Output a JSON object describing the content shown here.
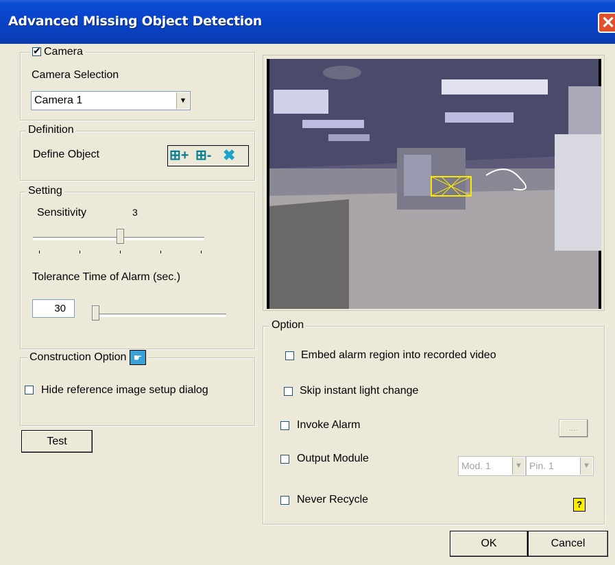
{
  "window": {
    "title": "Advanced Missing Object Detection"
  },
  "camera": {
    "group_label": "Camera",
    "checked": true,
    "selection_label": "Camera Selection",
    "selected": "Camera 1"
  },
  "definition": {
    "group_label": "Definition",
    "define_object_label": "Define Object",
    "tools": [
      "add-region-icon",
      "remove-region-icon",
      "clear-region-icon"
    ]
  },
  "setting": {
    "group_label": "Setting",
    "sensitivity_label": "Sensitivity",
    "sensitivity_value": "3",
    "tolerance_label": "Tolerance Time of Alarm (sec.)",
    "tolerance_value": "30"
  },
  "construction": {
    "group_label": "Construction Option",
    "hide_reference_label": "Hide reference image setup dialog"
  },
  "buttons": {
    "test": "Test",
    "ok": "OK",
    "cancel": "Cancel",
    "browse": "...."
  },
  "option": {
    "group_label": "Option",
    "embed_label": "Embed alarm region into recorded video",
    "skip_label": "Skip instant light change",
    "invoke_label": "Invoke Alarm",
    "output_label": "Output Module",
    "never_recycle_label": "Never Recycle",
    "module_value": "Mod. 1",
    "pin_value": "Pin. 1"
  },
  "colors": {
    "titlebar": "#0843c6",
    "close": "#e0502d",
    "region": "#ffe800"
  }
}
